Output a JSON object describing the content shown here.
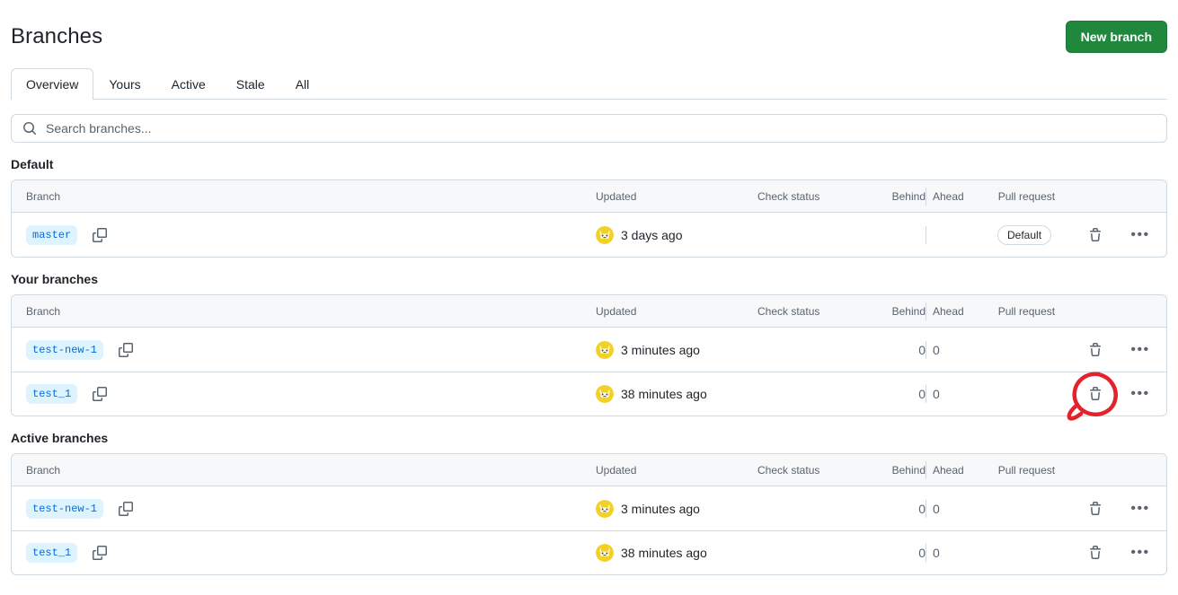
{
  "header": {
    "title": "Branches",
    "new_branch_label": "New branch"
  },
  "tabs": [
    {
      "label": "Overview",
      "selected": true
    },
    {
      "label": "Yours",
      "selected": false
    },
    {
      "label": "Active",
      "selected": false
    },
    {
      "label": "Stale",
      "selected": false
    },
    {
      "label": "All",
      "selected": false
    }
  ],
  "search": {
    "placeholder": "Search branches...",
    "value": "",
    "icon": "search-icon"
  },
  "columns": {
    "branch": "Branch",
    "updated": "Updated",
    "check_status": "Check status",
    "behind": "Behind",
    "ahead": "Ahead",
    "pull_request": "Pull request"
  },
  "icons": {
    "copy": "copy-icon",
    "trash": "trash-icon",
    "kebab": "•••"
  },
  "colors": {
    "green_button": "#1f883d",
    "branch_badge_bg": "#ddf4ff",
    "branch_badge_fg": "#0969da",
    "border": "#d1d9e0",
    "header_bg": "#f6f8fa",
    "muted_text": "#59636e",
    "annotation_red": "#e3232b",
    "avatar_yellow": "#f2d024"
  },
  "sections": [
    {
      "title": "Default",
      "rows": [
        {
          "branch": "master",
          "updated": "3 days ago",
          "check_status": "",
          "behind": "",
          "ahead": "",
          "pull_request": "Default",
          "pull_request_is_pill": true,
          "annotated": false
        }
      ]
    },
    {
      "title": "Your branches",
      "rows": [
        {
          "branch": "test-new-1",
          "updated": "3 minutes ago",
          "check_status": "",
          "behind": "0",
          "ahead": "0",
          "pull_request": "",
          "pull_request_is_pill": false,
          "annotated": false
        },
        {
          "branch": "test_1",
          "updated": "38 minutes ago",
          "check_status": "",
          "behind": "0",
          "ahead": "0",
          "pull_request": "",
          "pull_request_is_pill": false,
          "annotated": true
        }
      ]
    },
    {
      "title": "Active branches",
      "rows": [
        {
          "branch": "test-new-1",
          "updated": "3 minutes ago",
          "check_status": "",
          "behind": "0",
          "ahead": "0",
          "pull_request": "",
          "pull_request_is_pill": false,
          "annotated": false
        },
        {
          "branch": "test_1",
          "updated": "38 minutes ago",
          "check_status": "",
          "behind": "0",
          "ahead": "0",
          "pull_request": "",
          "pull_request_is_pill": false,
          "annotated": false
        }
      ]
    }
  ],
  "annotation": {
    "shape": "hand-drawn-red-circle",
    "target": "trash-icon of row test_1 in Your branches"
  }
}
